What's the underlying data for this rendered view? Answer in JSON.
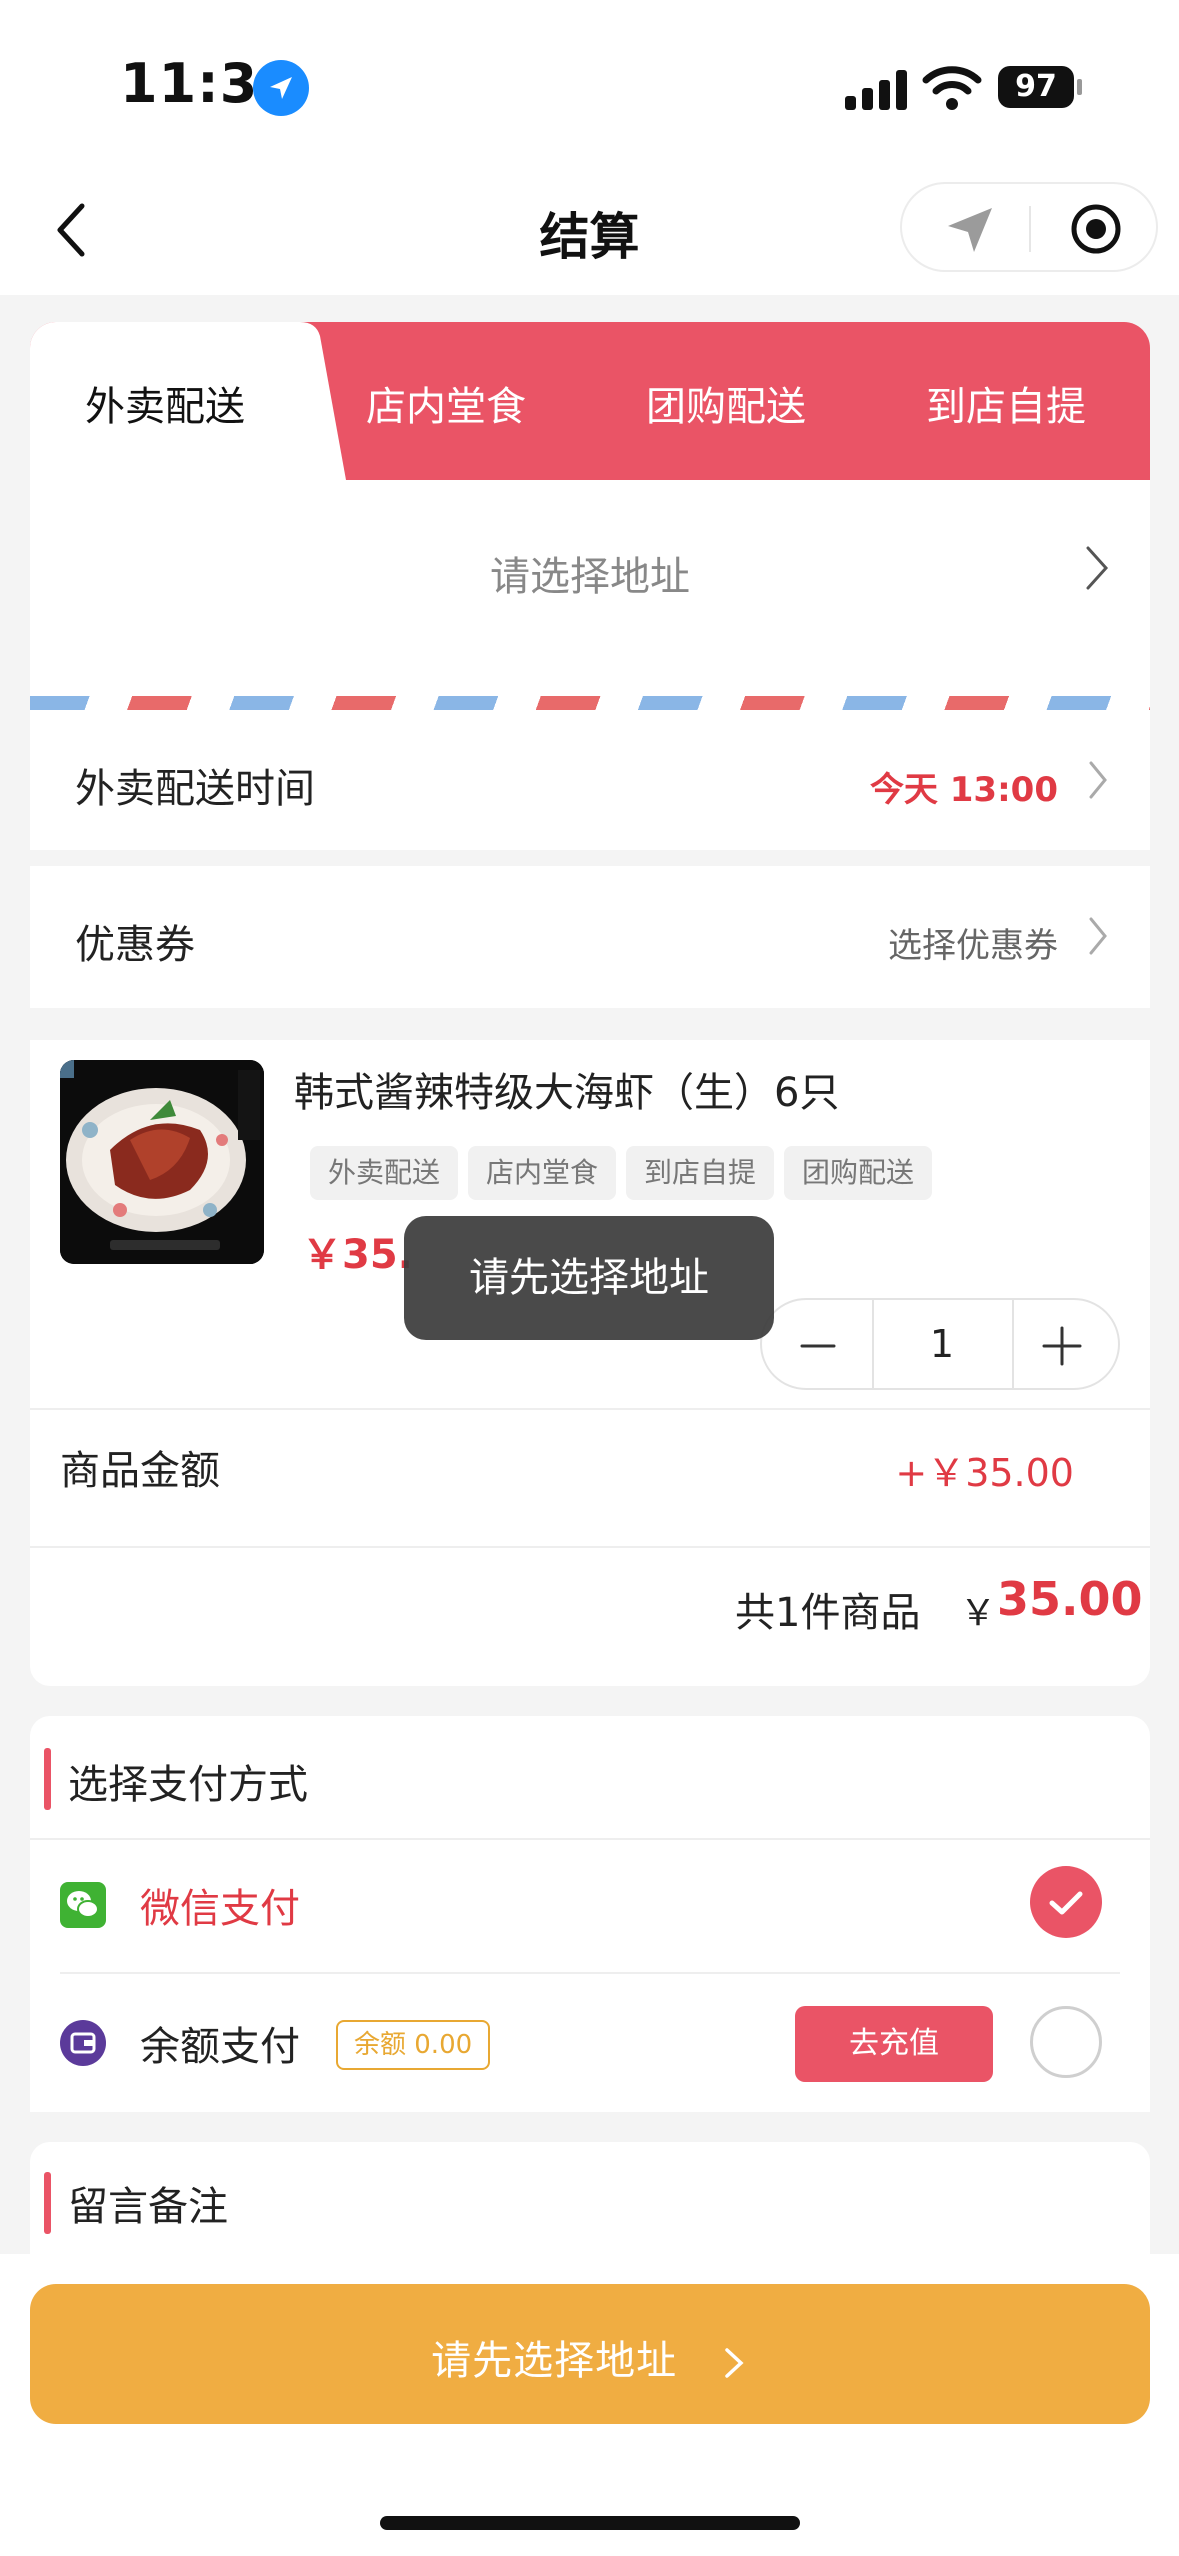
{
  "status_bar": {
    "time": "11:38",
    "battery": "97"
  },
  "header": {
    "title": "结算"
  },
  "delivery_tabs": [
    "外卖配送",
    "店内堂食",
    "团购配送",
    "到店自提"
  ],
  "address": {
    "placeholder": "请选择地址"
  },
  "delivery_time": {
    "label": "外卖配送时间",
    "value": "今天 13:00"
  },
  "coupon": {
    "label": "优惠券",
    "value": "选择优惠券"
  },
  "product": {
    "name": "韩式酱辣特级大海虾（生）6只",
    "tags": [
      "外卖配送",
      "店内堂食",
      "到店自提",
      "团购配送"
    ],
    "price": "￥35.",
    "quantity": "1"
  },
  "summary": {
    "goods_amount_label": "商品金额",
    "goods_amount_value": "+￥35.00",
    "total_count": "共1件商品",
    "total_currency": "￥",
    "total_value": "35.00"
  },
  "payment": {
    "section_title": "选择支付方式",
    "wechat_label": "微信支付",
    "balance_label": "余额支付",
    "balance_tag": "余额 0.00",
    "recharge_label": "去充值"
  },
  "note": {
    "section_title": "留言备注"
  },
  "submit": {
    "label": "请先选择地址"
  },
  "toast": {
    "message": "请先选择地址"
  },
  "colors": {
    "accent_red": "#ea5466",
    "price_red": "#e03a44",
    "submit_orange": "#f0ad42",
    "wechat_green": "#3fb233"
  }
}
